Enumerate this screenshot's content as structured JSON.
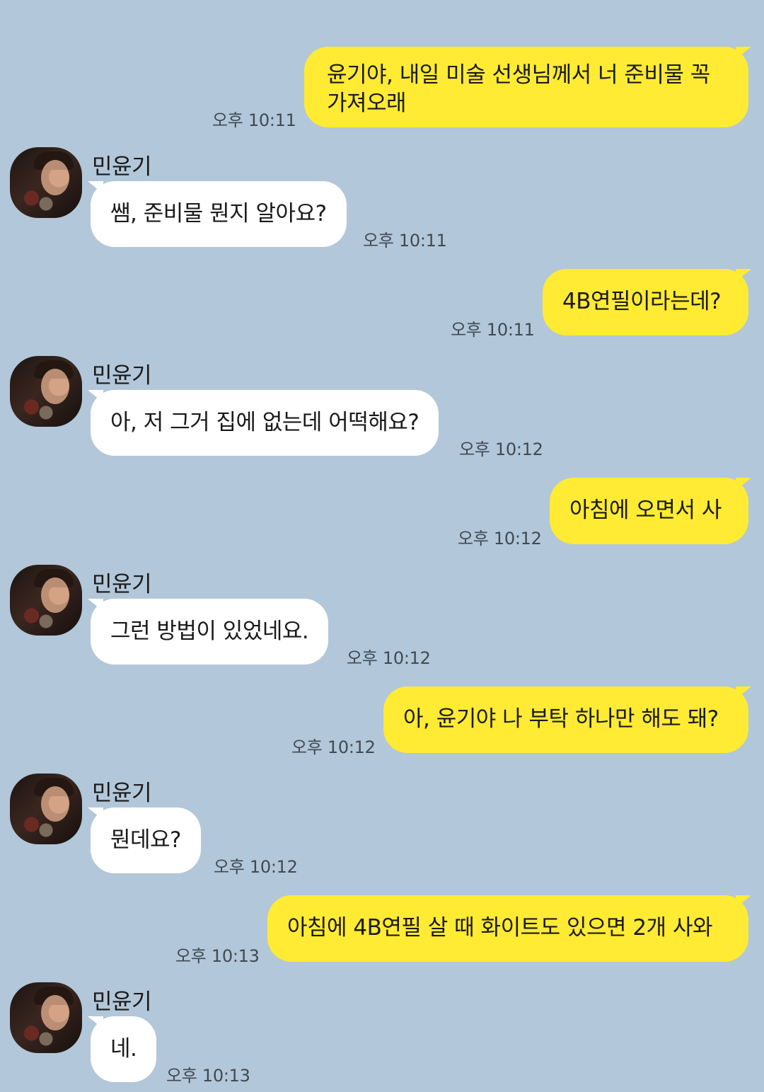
{
  "chat": {
    "contact_name": "민윤기",
    "messages": [
      {
        "from": "me",
        "text_lines": [
          "윤기야, 내일 미술 선생님께서 너 준비물 꼭",
          "가져오래"
        ],
        "time": "오후 10:11"
      },
      {
        "from": "them",
        "name": "민윤기",
        "text": "쌤, 준비물 뭔지 알아요?",
        "time": "오후 10:11"
      },
      {
        "from": "me",
        "text": "4B연필이라는데?",
        "time": "오후 10:11"
      },
      {
        "from": "them",
        "name": "민윤기",
        "text": "아, 저 그거 집에 없는데 어떡해요?",
        "time": "오후 10:12"
      },
      {
        "from": "me",
        "text": "아침에 오면서 사",
        "time": "오후 10:12"
      },
      {
        "from": "them",
        "name": "민윤기",
        "text": "그런 방법이 있었네요.",
        "time": "오후 10:12"
      },
      {
        "from": "me",
        "text": "아, 윤기야 나 부탁 하나만 해도 돼?",
        "time": "오후 10:12"
      },
      {
        "from": "them",
        "name": "민윤기",
        "text": "뭔데요?",
        "time": "오후 10:12"
      },
      {
        "from": "me",
        "text": "아침에 4B연필 살 때 화이트도 있으면 2개 사와",
        "time": "오후 10:13"
      },
      {
        "from": "them",
        "name": "민윤기",
        "text": "네.",
        "time": "오후 10:13"
      }
    ]
  },
  "colors": {
    "background": "#b2c7d9",
    "my_bubble": "#ffeb33",
    "their_bubble": "#ffffff"
  }
}
